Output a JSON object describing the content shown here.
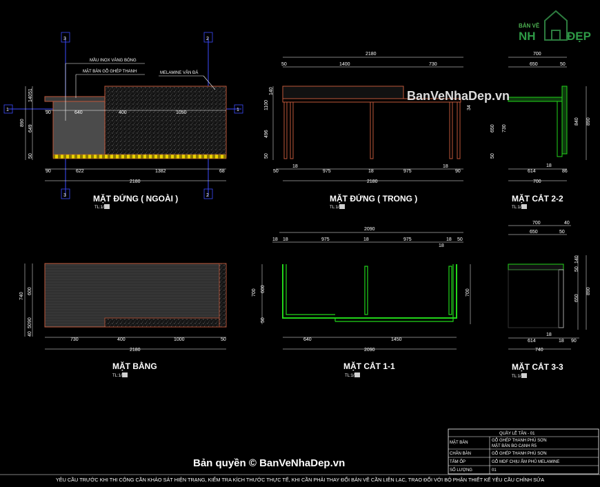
{
  "logo": {
    "line1": "BẢN VẼ",
    "line2a": "NH",
    "line2b": "ĐẸP"
  },
  "watermark_top": "BanVeNhaDep.vn",
  "watermark_bottom": "Bản quyền © BanVeNhaDep.vn",
  "axes": {
    "a3": "3",
    "a2": "2",
    "a1": "1"
  },
  "v1": {
    "title": "MẶT ĐỨNG ( NGOÀI )",
    "scale": "TL:1/",
    "lbl1": "MẦU INOX VÀNG BÓNG",
    "lbl2": "MẶT BÀN GỖ GHÉP THANH",
    "lbl3": "MELAMINE VÂN ĐÁ",
    "top": [
      "90",
      "640",
      "400",
      "1050"
    ],
    "bottom": [
      "90",
      "622",
      "1382",
      "68"
    ],
    "total": "2180",
    "left": [
      "51",
      "140",
      "890",
      "649",
      "50"
    ]
  },
  "v2": {
    "title": "MẶT ĐỨNG ( TRONG )",
    "scale": "TL:1/",
    "top_total": "2180",
    "top": [
      "50",
      "1400",
      "730"
    ],
    "bottom": [
      "50",
      "18",
      "975",
      "18",
      "975",
      "18",
      "90"
    ],
    "total": "2180",
    "left": [
      "140",
      "1100",
      "496",
      "50"
    ],
    "right_small": "34"
  },
  "v3": {
    "title": "MẶT CẮT 2-2",
    "scale": "TL:1/",
    "top_total": "700",
    "top": [
      "650",
      "50"
    ],
    "bottom": [
      "614",
      "86"
    ],
    "b18": "18",
    "total": "700",
    "left": [
      "650"
    ],
    "left2": "730",
    "right": [
      "840",
      "890"
    ],
    "l50": "50"
  },
  "v4": {
    "title": "MẶT BẰNG",
    "scale": "TL:1/",
    "bottom": [
      "730",
      "400",
      "1000",
      "50"
    ],
    "total": "2180",
    "left": [
      "740",
      "600",
      "90",
      "50",
      "40"
    ]
  },
  "v5": {
    "title": "MẶT CẮT 1-1",
    "scale": "TL:1/",
    "top_total": "2090",
    "top": [
      "18",
      "18",
      "975",
      "18",
      "975",
      "18",
      "50"
    ],
    "small18": "18",
    "bottom": [
      "640",
      "1450"
    ],
    "total": "2090",
    "left": [
      "700",
      "600",
      "50"
    ],
    "right": "700"
  },
  "v6": {
    "title": "MẶT CẮT 3-3",
    "scale": "TL:1/",
    "top": [
      "700",
      "40"
    ],
    "top2": [
      "650",
      "50"
    ],
    "bottom": [
      "614",
      "18",
      "90"
    ],
    "b18": "18",
    "total": "740",
    "right": [
      "140",
      "50",
      "650",
      "890"
    ]
  },
  "titleblock": {
    "header": "QUẦY LỄ TÂN - 01",
    "rows": [
      {
        "k": "MẶT BÀN",
        "v": "GỖ GHÉP THANH PHÚ SƠN"
      },
      {
        "k": "",
        "v": "MẶT BÀN BO CẠNH R5"
      },
      {
        "k": "CHÂN BÀN",
        "v": "GỖ GHÉP THANH PHÚ SƠN"
      },
      {
        "k": "TẤM ỐP",
        "v": "GỖ MDF CHỊU ẨM PHỦ MELAMINE"
      },
      {
        "k": "SỐ LƯỢNG",
        "v": "01"
      }
    ]
  },
  "footer": "YÊU CẦU TRƯỚC KHI THI CÔNG CẦN KHẢO SÁT HIỆN TRẠNG, KIỂM TRA KÍCH THƯỚC THỰC TẾ, KHI CẦN PHẢI THAY ĐỔI BẢN VẼ CẦN LIÊN LẠC, TRAO ĐỔI VỚI BỘ PHẬN THIẾT KẾ YÊU CẦU CHỈNH SỬA",
  "colors": {
    "bg": "#000000",
    "wood": "#c0573a",
    "green": "#22d61a",
    "axis": "#3b4bff",
    "yellow": "#e8d200",
    "dim": "#ffffff"
  }
}
